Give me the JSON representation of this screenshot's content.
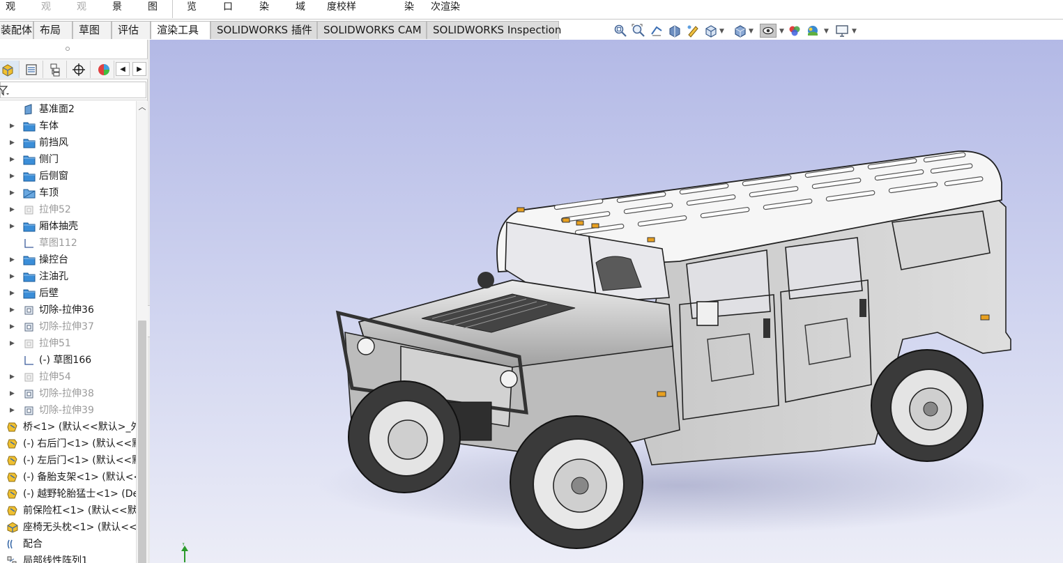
{
  "command_row": {
    "items": [
      {
        "label": "观",
        "dim": false
      },
      {
        "label": "观",
        "dim": true
      },
      {
        "label": "观",
        "dim": true
      },
      {
        "label": "景",
        "dim": false
      },
      {
        "label": "图",
        "dim": false
      },
      {
        "label": "览",
        "dim": false
      },
      {
        "label": "口",
        "dim": false
      },
      {
        "label": "染",
        "dim": false
      },
      {
        "label": "域",
        "dim": false
      },
      {
        "label": "度校样",
        "dim": false
      },
      {
        "label": "染",
        "dim": false
      },
      {
        "label": "次渲染",
        "dim": false
      }
    ]
  },
  "tabs": [
    {
      "label": "装配体",
      "state": "normal"
    },
    {
      "label": "布局",
      "state": "normal"
    },
    {
      "label": "草图",
      "state": "normal"
    },
    {
      "label": "评估",
      "state": "normal"
    },
    {
      "label": "渲染工具",
      "state": "active"
    },
    {
      "label": "SOLIDWORKS 插件",
      "state": "grey"
    },
    {
      "label": "SOLIDWORKS CAM",
      "state": "grey"
    },
    {
      "label": "SOLIDWORKS Inspection",
      "state": "grey"
    }
  ],
  "heads_up_toolbar": [
    "zoom-to-fit-icon",
    "zoom-to-area-icon",
    "previous-view-icon",
    "section-view-icon",
    "dynamic-annotation-icon",
    "view-orientation-icon",
    "display-style-icon",
    "hide-show-items-icon",
    "edit-appearance-icon",
    "apply-scene-icon",
    "view-settings-icon"
  ],
  "feature_tree": {
    "items": [
      {
        "label": "基准面2",
        "icon": "plane-icon",
        "expandable": false,
        "suppressed": false,
        "level": 1
      },
      {
        "label": "车体",
        "icon": "folder-icon",
        "expandable": true,
        "suppressed": false,
        "level": 1
      },
      {
        "label": "前挡风",
        "icon": "folder-icon",
        "expandable": true,
        "suppressed": false,
        "level": 1
      },
      {
        "label": "侧门",
        "icon": "folder-icon",
        "expandable": true,
        "suppressed": false,
        "level": 1
      },
      {
        "label": "后侧窗",
        "icon": "folder-icon",
        "expandable": true,
        "suppressed": false,
        "level": 1
      },
      {
        "label": "车顶",
        "icon": "folder-open-icon",
        "expandable": true,
        "suppressed": false,
        "level": 1
      },
      {
        "label": "拉伸52",
        "icon": "extrude-icon",
        "expandable": true,
        "suppressed": true,
        "level": 1
      },
      {
        "label": "厢体抽壳",
        "icon": "folder-icon",
        "expandable": true,
        "suppressed": false,
        "level": 1
      },
      {
        "label": "草图112",
        "icon": "sketch-icon",
        "expandable": false,
        "suppressed": true,
        "level": 1
      },
      {
        "label": "操控台",
        "icon": "folder-icon",
        "expandable": true,
        "suppressed": false,
        "level": 1
      },
      {
        "label": "注油孔",
        "icon": "folder-icon",
        "expandable": true,
        "suppressed": false,
        "level": 1
      },
      {
        "label": "后壁",
        "icon": "folder-icon",
        "expandable": true,
        "suppressed": false,
        "level": 1
      },
      {
        "label": "切除-拉伸36",
        "icon": "cut-extrude-icon",
        "expandable": true,
        "suppressed": false,
        "level": 1
      },
      {
        "label": "切除-拉伸37",
        "icon": "cut-extrude-icon",
        "expandable": true,
        "suppressed": true,
        "level": 1
      },
      {
        "label": "拉伸51",
        "icon": "extrude-icon",
        "expandable": true,
        "suppressed": true,
        "level": 1
      },
      {
        "label": "(-) 草图166",
        "icon": "sketch-icon",
        "expandable": false,
        "suppressed": false,
        "level": 1
      },
      {
        "label": "拉伸54",
        "icon": "extrude-icon",
        "expandable": true,
        "suppressed": true,
        "level": 1
      },
      {
        "label": "切除-拉伸38",
        "icon": "cut-extrude-icon",
        "expandable": true,
        "suppressed": true,
        "level": 1
      },
      {
        "label": "切除-拉伸39",
        "icon": "cut-extrude-icon",
        "expandable": true,
        "suppressed": true,
        "level": 1
      },
      {
        "label": "桥<1> (默认<<默认>_外",
        "icon": "part-icon",
        "expandable": false,
        "suppressed": false,
        "level": 0
      },
      {
        "label": "(-) 右后门<1> (默认<<默",
        "icon": "part-icon",
        "expandable": false,
        "suppressed": false,
        "level": 0
      },
      {
        "label": "(-) 左后门<1> (默认<<默",
        "icon": "part-icon",
        "expandable": false,
        "suppressed": false,
        "level": 0
      },
      {
        "label": "(-) 备胎支架<1> (默认<<",
        "icon": "part-icon",
        "expandable": false,
        "suppressed": false,
        "level": 0
      },
      {
        "label": "(-) 越野轮胎猛士<1> (Def",
        "icon": "part-icon",
        "expandable": false,
        "suppressed": false,
        "level": 0
      },
      {
        "label": "前保险杠<1> (默认<<默认",
        "icon": "part-icon",
        "expandable": false,
        "suppressed": false,
        "level": 0
      },
      {
        "label": "座椅无头枕<1> (默认<<默",
        "icon": "assembly-icon",
        "expandable": false,
        "suppressed": false,
        "level": 0
      },
      {
        "label": "配合",
        "icon": "mates-icon",
        "expandable": false,
        "suppressed": false,
        "level": 0
      },
      {
        "label": "局部线性阵列1",
        "icon": "pattern-icon",
        "expandable": false,
        "suppressed": false,
        "level": 0
      }
    ]
  },
  "viewport": {
    "model": "suv-assembly-model",
    "triad_axis": "Y",
    "colors": {
      "background_top": "#b3b9e6",
      "background_bottom": "#ecedf7",
      "body": "#d9d9d9",
      "roof": "#f4f4f4",
      "tire": "#3a3a3a",
      "lamp": "#e8a020"
    }
  }
}
